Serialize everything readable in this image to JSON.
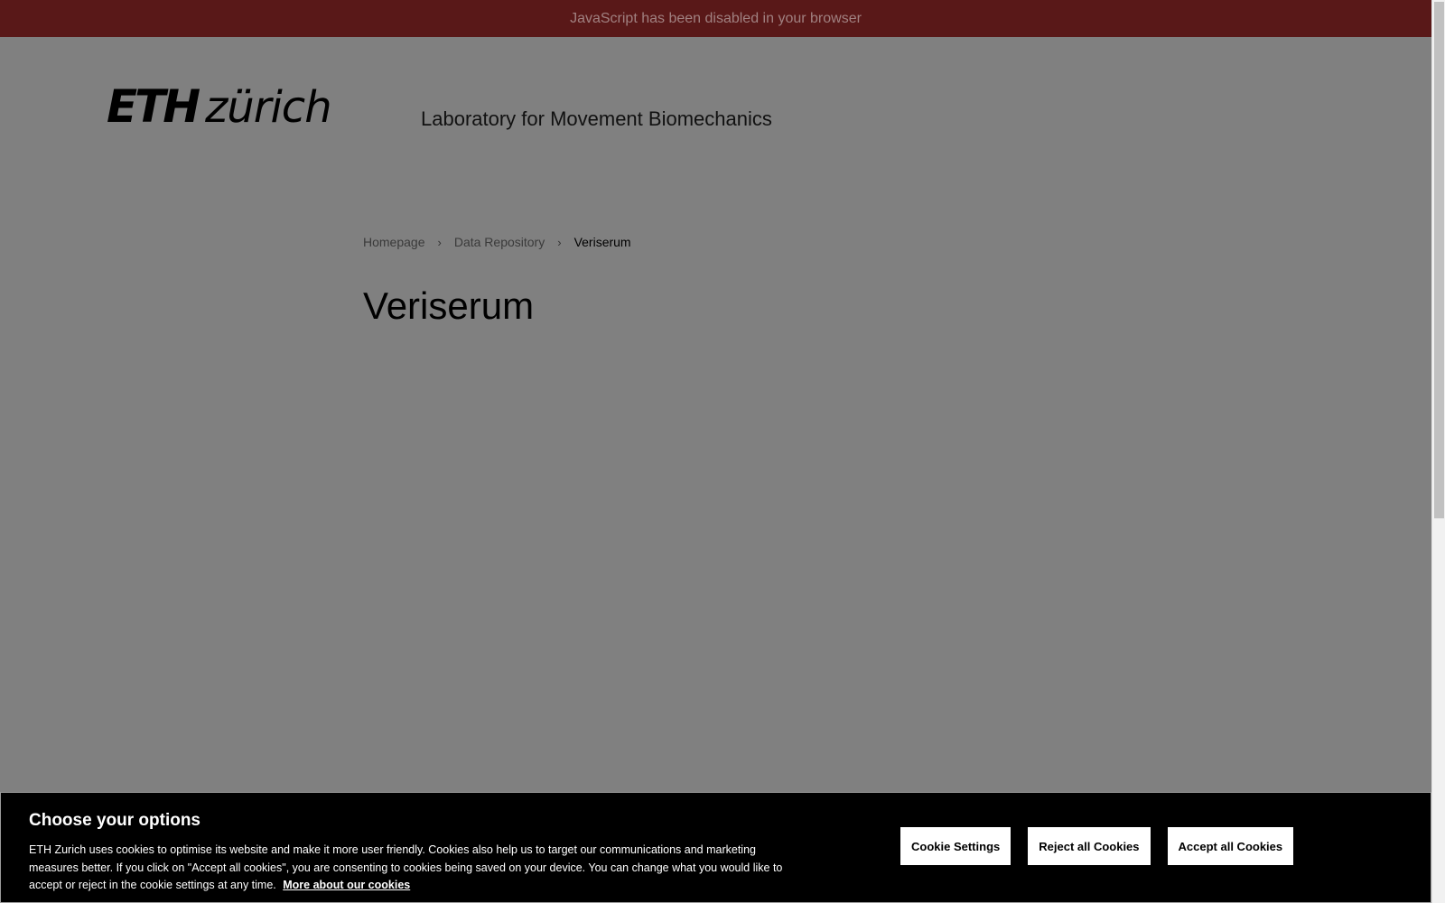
{
  "banner": {
    "js_disabled": "JavaScript has been disabled in your browser"
  },
  "header": {
    "logo_eth": "ETH",
    "logo_zurich": "zürich",
    "site_title": "Laboratory for Movement Biomechanics"
  },
  "breadcrumb": {
    "items": [
      "Homepage",
      "Data Repository",
      "Veriserum"
    ],
    "separator": "›"
  },
  "page": {
    "title": "Veriserum"
  },
  "cookies": {
    "heading": "Choose your options",
    "text": "ETH Zurich uses cookies to optimise its website and make it more user friendly. Cookies also help us to target our communications and marketing measures better. If you click on \"Accept all cookies\", you are consenting to cookies being saved on your device. You can change what you would like to accept or reject in the cookie settings at any time.",
    "link": "More about our cookies",
    "settings_label": "Cookie Settings",
    "reject_label": "Reject all Cookies",
    "accept_label": "Accept all Cookies"
  },
  "colors": {
    "banner_bg": "#591818",
    "overlay": "#808080",
    "cookie_bg": "#000000"
  }
}
